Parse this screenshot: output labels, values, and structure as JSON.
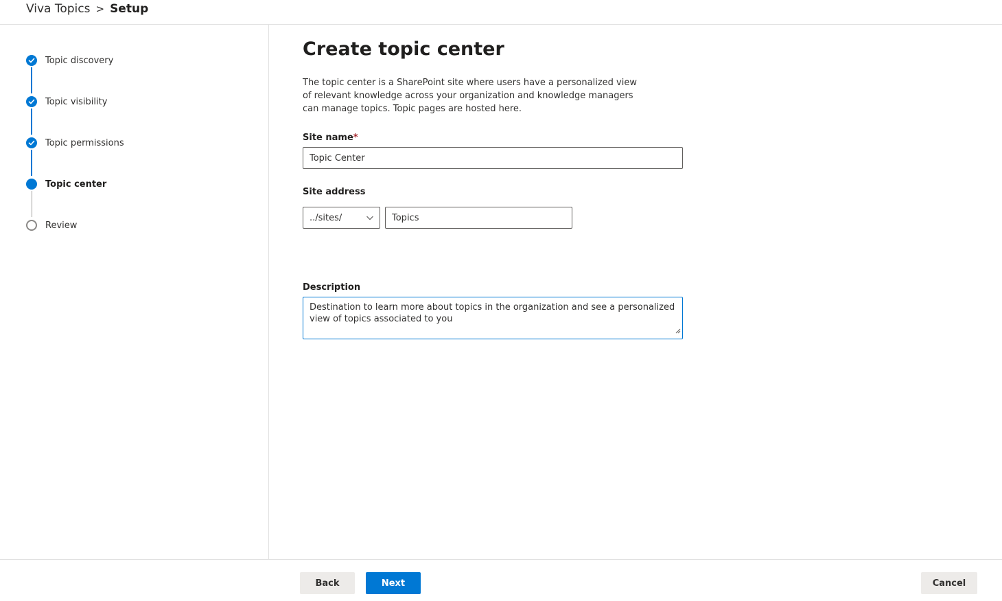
{
  "breadcrumb": {
    "root": "Viva Topics",
    "separator": ">",
    "current": "Setup"
  },
  "steps": [
    {
      "label": "Topic discovery",
      "state": "done"
    },
    {
      "label": "Topic visibility",
      "state": "done"
    },
    {
      "label": "Topic permissions",
      "state": "done"
    },
    {
      "label": "Topic center",
      "state": "current"
    },
    {
      "label": "Review",
      "state": "todo"
    }
  ],
  "main": {
    "title": "Create topic center",
    "intro": "The topic center is a SharePoint site where users have a personalized view of relevant knowledge across your organization and knowledge managers can manage topics. Topic pages are hosted here.",
    "site_name": {
      "label": "Site name",
      "required_marker": "*",
      "value": "Topic Center"
    },
    "site_address": {
      "label": "Site address",
      "prefix_selected": "../sites/",
      "value": "Topics"
    },
    "description": {
      "label": "Description",
      "value": "Destination to learn more about topics in the organization and see a personalized view of topics associated to you"
    }
  },
  "footer": {
    "back_label": "Back",
    "next_label": "Next",
    "cancel_label": "Cancel"
  },
  "colors": {
    "accent": "#0078d4",
    "required": "#a4262c",
    "secondary_button": "#edebe9"
  },
  "icons": {
    "step_done": "checkmark-circle-icon",
    "step_current": "filled-circle-icon",
    "step_todo": "empty-circle-icon",
    "dropdown": "chevron-down-icon"
  }
}
